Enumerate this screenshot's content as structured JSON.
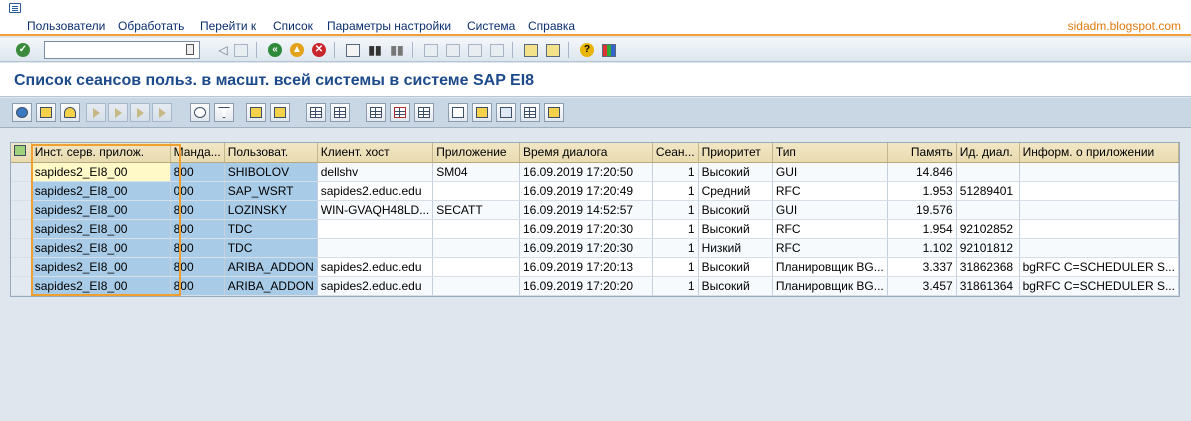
{
  "menu": {
    "items": [
      "Пользователи",
      "Обработать",
      "Перейти к",
      "Список",
      "Параметры настройки",
      "Система",
      "Справка"
    ],
    "watermark": "sidadm.blogspot.com"
  },
  "toolbar": {
    "command_value": ""
  },
  "page": {
    "title": "Список сеансов польз. в масшт. всей системы в системе SAP EI8"
  },
  "table": {
    "columns": [
      "Инст. серв. прилож.",
      "Манда...",
      "Пользоват.",
      "Клиент. хост",
      "Приложение",
      "Время диалога",
      "Сеан...",
      "Приоритет",
      "Тип",
      "Память",
      "Ид. диал.",
      "Информ. о приложении"
    ],
    "rows": [
      [
        "sapides2_EI8_00",
        "800",
        "SHIBOLOV",
        "dellshv",
        "SM04",
        "16.09.2019 17:20:50",
        "1",
        "Высокий",
        "GUI",
        "14.846",
        "",
        ""
      ],
      [
        "sapides2_EI8_00",
        "000",
        "SAP_WSRT",
        "sapides2.educ.edu",
        "",
        "16.09.2019 17:20:49",
        "1",
        "Средний",
        "RFC",
        "1.953",
        "51289401",
        ""
      ],
      [
        "sapides2_EI8_00",
        "800",
        "LOZINSKY",
        "WIN-GVAQH48LD...",
        "SECATT",
        "16.09.2019 14:52:57",
        "1",
        "Высокий",
        "GUI",
        "19.576",
        "",
        ""
      ],
      [
        "sapides2_EI8_00",
        "800",
        "TDC",
        "",
        "",
        "16.09.2019 17:20:30",
        "1",
        "Высокий",
        "RFC",
        "1.954",
        "92102852",
        ""
      ],
      [
        "sapides2_EI8_00",
        "800",
        "TDC",
        "",
        "",
        "16.09.2019 17:20:30",
        "1",
        "Низкий",
        "RFC",
        "1.102",
        "92101812",
        ""
      ],
      [
        "sapides2_EI8_00",
        "800",
        "ARIBA_ADDON",
        "sapides2.educ.edu",
        "",
        "16.09.2019 17:20:13",
        "1",
        "Высокий",
        "Планировщик BG...",
        "3.337",
        "31862368",
        "bgRFC C=SCHEDULER S..."
      ],
      [
        "sapides2_EI8_00",
        "800",
        "ARIBA_ADDON",
        "sapides2.educ.edu",
        "",
        "16.09.2019 17:20:20",
        "1",
        "Высокий",
        "Планировщик BG...",
        "3.457",
        "31861364",
        "bgRFC C=SCHEDULER S..."
      ]
    ]
  },
  "colors": {
    "accent_orange": "#f0a030",
    "title_blue": "#1c4a8a",
    "key_column": "#a8cbe8",
    "header_bg": "#e9dbaf"
  }
}
